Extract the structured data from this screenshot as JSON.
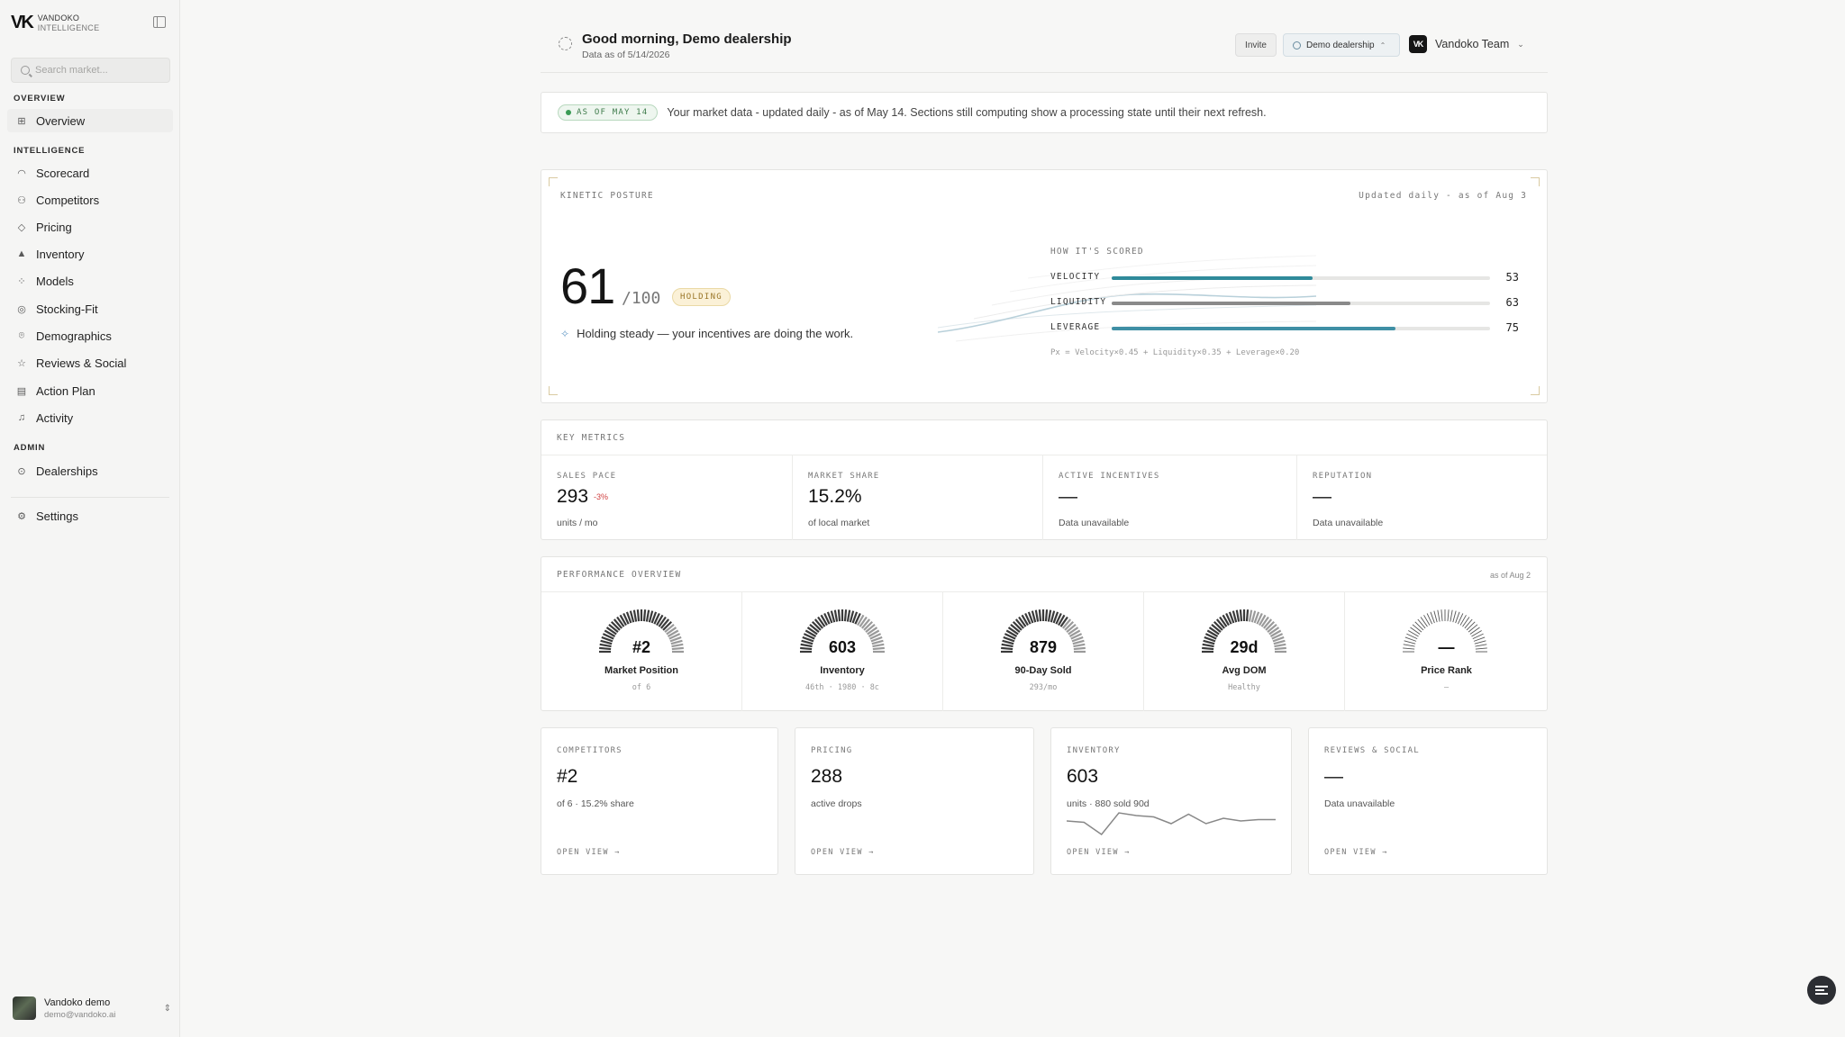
{
  "sidebar": {
    "brand_name": "VANDOKO",
    "brand_sub": "INTELLIGENCE",
    "search_placeholder": "Search market...",
    "sections": {
      "overview": "OVERVIEW",
      "intelligence": "INTELLIGENCE",
      "admin": "ADMIN"
    },
    "items": [
      {
        "label": "Overview",
        "icon": "grid-icon"
      },
      {
        "label": "Scorecard",
        "icon": "gauge-icon"
      },
      {
        "label": "Competitors",
        "icon": "users-icon"
      },
      {
        "label": "Pricing",
        "icon": "tag-icon"
      },
      {
        "label": "Inventory",
        "icon": "boxes-icon"
      },
      {
        "label": "Models",
        "icon": "models-icon"
      },
      {
        "label": "Stocking-Fit",
        "icon": "target-icon"
      },
      {
        "label": "Demographics",
        "icon": "map-pin-icon"
      },
      {
        "label": "Reviews & Social",
        "icon": "star-icon"
      },
      {
        "label": "Action Plan",
        "icon": "clipboard-icon"
      },
      {
        "label": "Activity",
        "icon": "bell-icon"
      },
      {
        "label": "Dealerships",
        "icon": "circle-icon"
      },
      {
        "label": "Settings",
        "icon": "gear-icon"
      }
    ],
    "user": {
      "name": "Vandoko demo",
      "email": "demo@vandoko.ai"
    }
  },
  "header": {
    "greeting": "Good morning, Demo dealership",
    "data_as_of": "Data as of 5/14/2026",
    "invite_label": "Invite",
    "dealer_label": "Demo dealership",
    "dealer_chevron": "⌃",
    "team_logo": "VK",
    "team_label": "Vandoko Team"
  },
  "banner": {
    "pill": "AS OF MAY 14",
    "text": "Your market data - updated daily - as of May 14. Sections still computing show a processing state until their next refresh."
  },
  "kinetic": {
    "label": "KINETIC POSTURE",
    "updated": "Updated daily - as of Aug 3",
    "score": "61",
    "score_max": "/100",
    "status": "HOLDING",
    "message": "Holding steady — your incentives are doing the work.",
    "how_label": "HOW IT'S SCORED",
    "components": [
      {
        "name": "VELOCITY",
        "value": 53,
        "color": "#2f8a9a"
      },
      {
        "name": "LIQUIDITY",
        "value": 63,
        "color": "#8a8a8a"
      },
      {
        "name": "LEVERAGE",
        "value": 75,
        "color": "#3f8fa5"
      }
    ],
    "formula": "Px = Velocity×0.45 + Liquidity×0.35 + Leverage×0.20"
  },
  "key_metrics": {
    "label": "KEY METRICS",
    "items": [
      {
        "label": "SALES PACE",
        "value": "293",
        "delta": "-3%",
        "sub": "units / mo"
      },
      {
        "label": "MARKET SHARE",
        "value": "15.2%",
        "sub": "of local market"
      },
      {
        "label": "ACTIVE INCENTIVES",
        "value": "—",
        "sub": "Data unavailable"
      },
      {
        "label": "REPUTATION",
        "value": "—",
        "sub": "Data unavailable"
      }
    ]
  },
  "performance": {
    "label": "PERFORMANCE OVERVIEW",
    "as_of": "as of Aug 2",
    "gauges": [
      {
        "value": "#2",
        "name": "Market Position",
        "sub": "of 6",
        "level": 0.75
      },
      {
        "value": "603",
        "name": "Inventory",
        "sub": "46th · 1980 · 8c",
        "level": 0.65
      },
      {
        "value": "879",
        "name": "90-Day Sold",
        "sub": "293/mo",
        "level": 0.7
      },
      {
        "value": "29d",
        "name": "Avg DOM",
        "sub": "Healthy",
        "level": 0.55
      },
      {
        "value": "—",
        "name": "Price Rank",
        "sub": "–",
        "level": 0
      }
    ]
  },
  "cards": [
    {
      "label": "COMPETITORS",
      "value": "#2",
      "sub": "of 6 · 15.2% share",
      "open": "OPEN VIEW →"
    },
    {
      "label": "PRICING",
      "value": "288",
      "sub": "active drops",
      "open": "OPEN VIEW →"
    },
    {
      "label": "INVENTORY",
      "value": "603",
      "sub": "units · 880 sold 90d",
      "open": "OPEN VIEW →"
    },
    {
      "label": "REVIEWS & SOCIAL",
      "value": "—",
      "sub": "Data unavailable",
      "open": "OPEN VIEW →"
    }
  ],
  "inventory_sparkline": [
    14,
    13,
    4,
    20,
    18,
    17,
    12,
    19,
    12,
    16,
    14,
    15,
    15
  ],
  "colors": {
    "accent": "#2f8a9a",
    "holding": "#9a7628",
    "negative": "#d04040"
  }
}
